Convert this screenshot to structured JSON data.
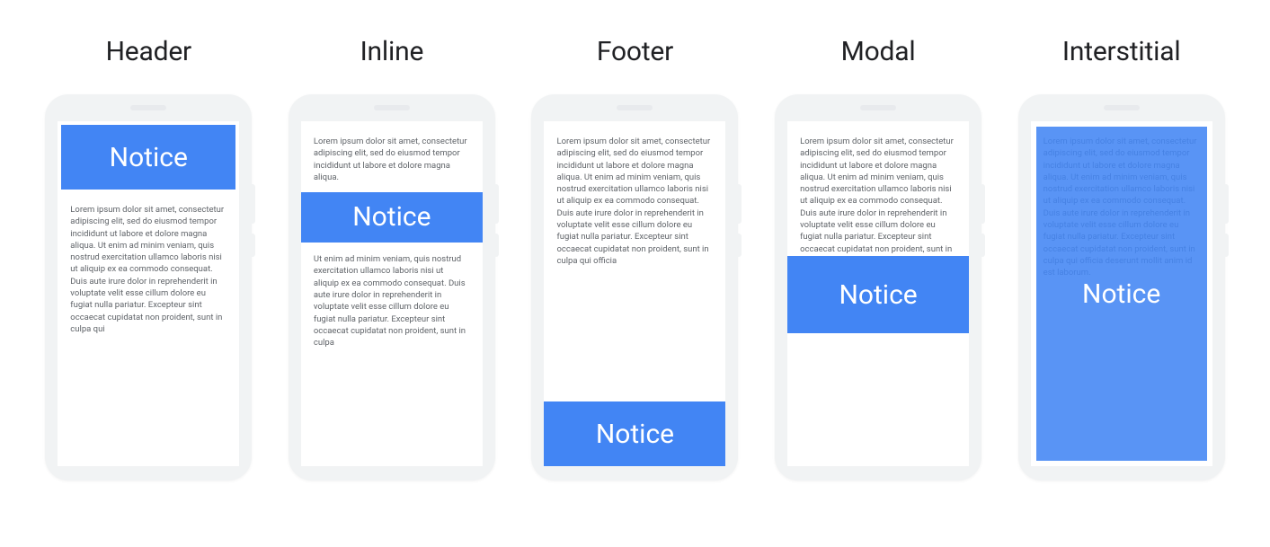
{
  "noticeLabel": "Notice",
  "text": {
    "para1": "Lorem ipsum dolor sit amet, consectetur adipiscing elit, sed do eiusmod tempor incididunt ut labore et dolore magna aliqua. Ut enim ad minim veniam, quis nostrud exercitation ullamco laboris nisi ut aliquip ex ea commodo consequat. Duis aute irure dolor in reprehenderit in voluptate velit esse cillum dolore eu fugiat nulla pariatur. Excepteur sint occaecat cupidatat non proident, sunt in culpa qui",
    "short1": "Lorem ipsum dolor sit amet, consectetur adipiscing elit, sed do eiusmod tempor incididunt ut labore et dolore magna aliqua.",
    "short2": "Ut enim ad minim veniam, quis nostrud exercitation ullamco laboris nisi ut aliquip ex ea commodo consequat. Duis aute irure dolor in reprehenderit in voluptate velit esse cillum dolore eu fugiat nulla pariatur. Excepteur sint occaecat cupidatat non proident, sunt in culpa",
    "footerPara": "Lorem ipsum dolor sit amet, consectetur adipiscing elit, sed do eiusmod tempor incididunt ut labore et dolore magna aliqua. Ut enim ad minim veniam, quis nostrud exercitation ullamco laboris nisi ut aliquip ex ea commodo consequat. Duis aute irure dolor in reprehenderit in voluptate velit esse cillum dolore eu fugiat nulla pariatur. Excepteur sint occaecat cupidatat non proident, sunt in culpa qui officia",
    "modalPara": "Lorem ipsum dolor sit amet, consectetur adipiscing elit, sed do eiusmod tempor incididunt ut labore et dolore magna aliqua. Ut enim ad minim veniam, quis nostrud exercitation ullamco laboris nisi ut aliquip ex ea commodo consequat. Duis aute irure dolor in reprehenderit in voluptate velit esse cillum dolore eu fugiat nulla pariatur. Excepteur sint occaecat cupidatat non proident, sunt in culpa qui officia deserunt mollit anim id est laborum.",
    "interstitialPara": "Lorem ipsum dolor sit amet, consectetur adipiscing elit, sed do eiusmod tempor incididunt ut labore et dolore magna aliqua. Ut enim ad minim veniam, quis nostrud exercitation ullamco laboris nisi ut aliquip ex ea commodo consequat. Duis aute irure dolor in reprehenderit in voluptate velit esse cillum dolore eu fugiat nulla pariatur. Excepteur sint occaecat cupidatat non proident, sunt in culpa qui officia deserunt mollit anim id est laborum."
  },
  "examples": [
    {
      "title": "Header"
    },
    {
      "title": "Inline"
    },
    {
      "title": "Footer"
    },
    {
      "title": "Modal"
    },
    {
      "title": "Interstitial"
    }
  ]
}
